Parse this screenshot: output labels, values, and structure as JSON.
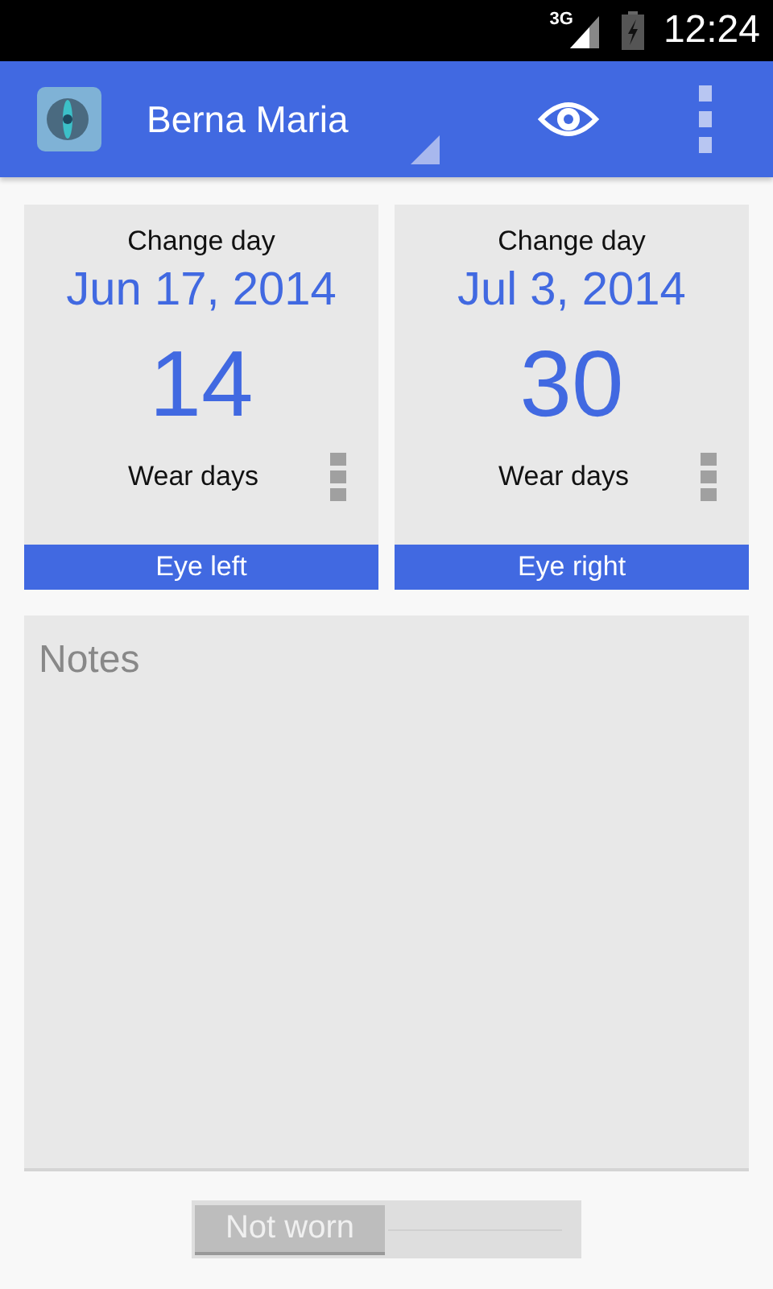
{
  "status_bar": {
    "network": "3G",
    "time": "12:24"
  },
  "app_bar": {
    "title": "Berna Maria"
  },
  "eyes": [
    {
      "heading": "Change day",
      "date": "Jun 17, 2014",
      "count": "14",
      "count_label": "Wear days",
      "label": "Eye left"
    },
    {
      "heading": "Change day",
      "date": "Jul 3, 2014",
      "count": "30",
      "count_label": "Wear days",
      "label": "Eye right"
    }
  ],
  "notes": {
    "placeholder": "Notes"
  },
  "worn_switch": {
    "label": "Not worn",
    "on": false
  }
}
